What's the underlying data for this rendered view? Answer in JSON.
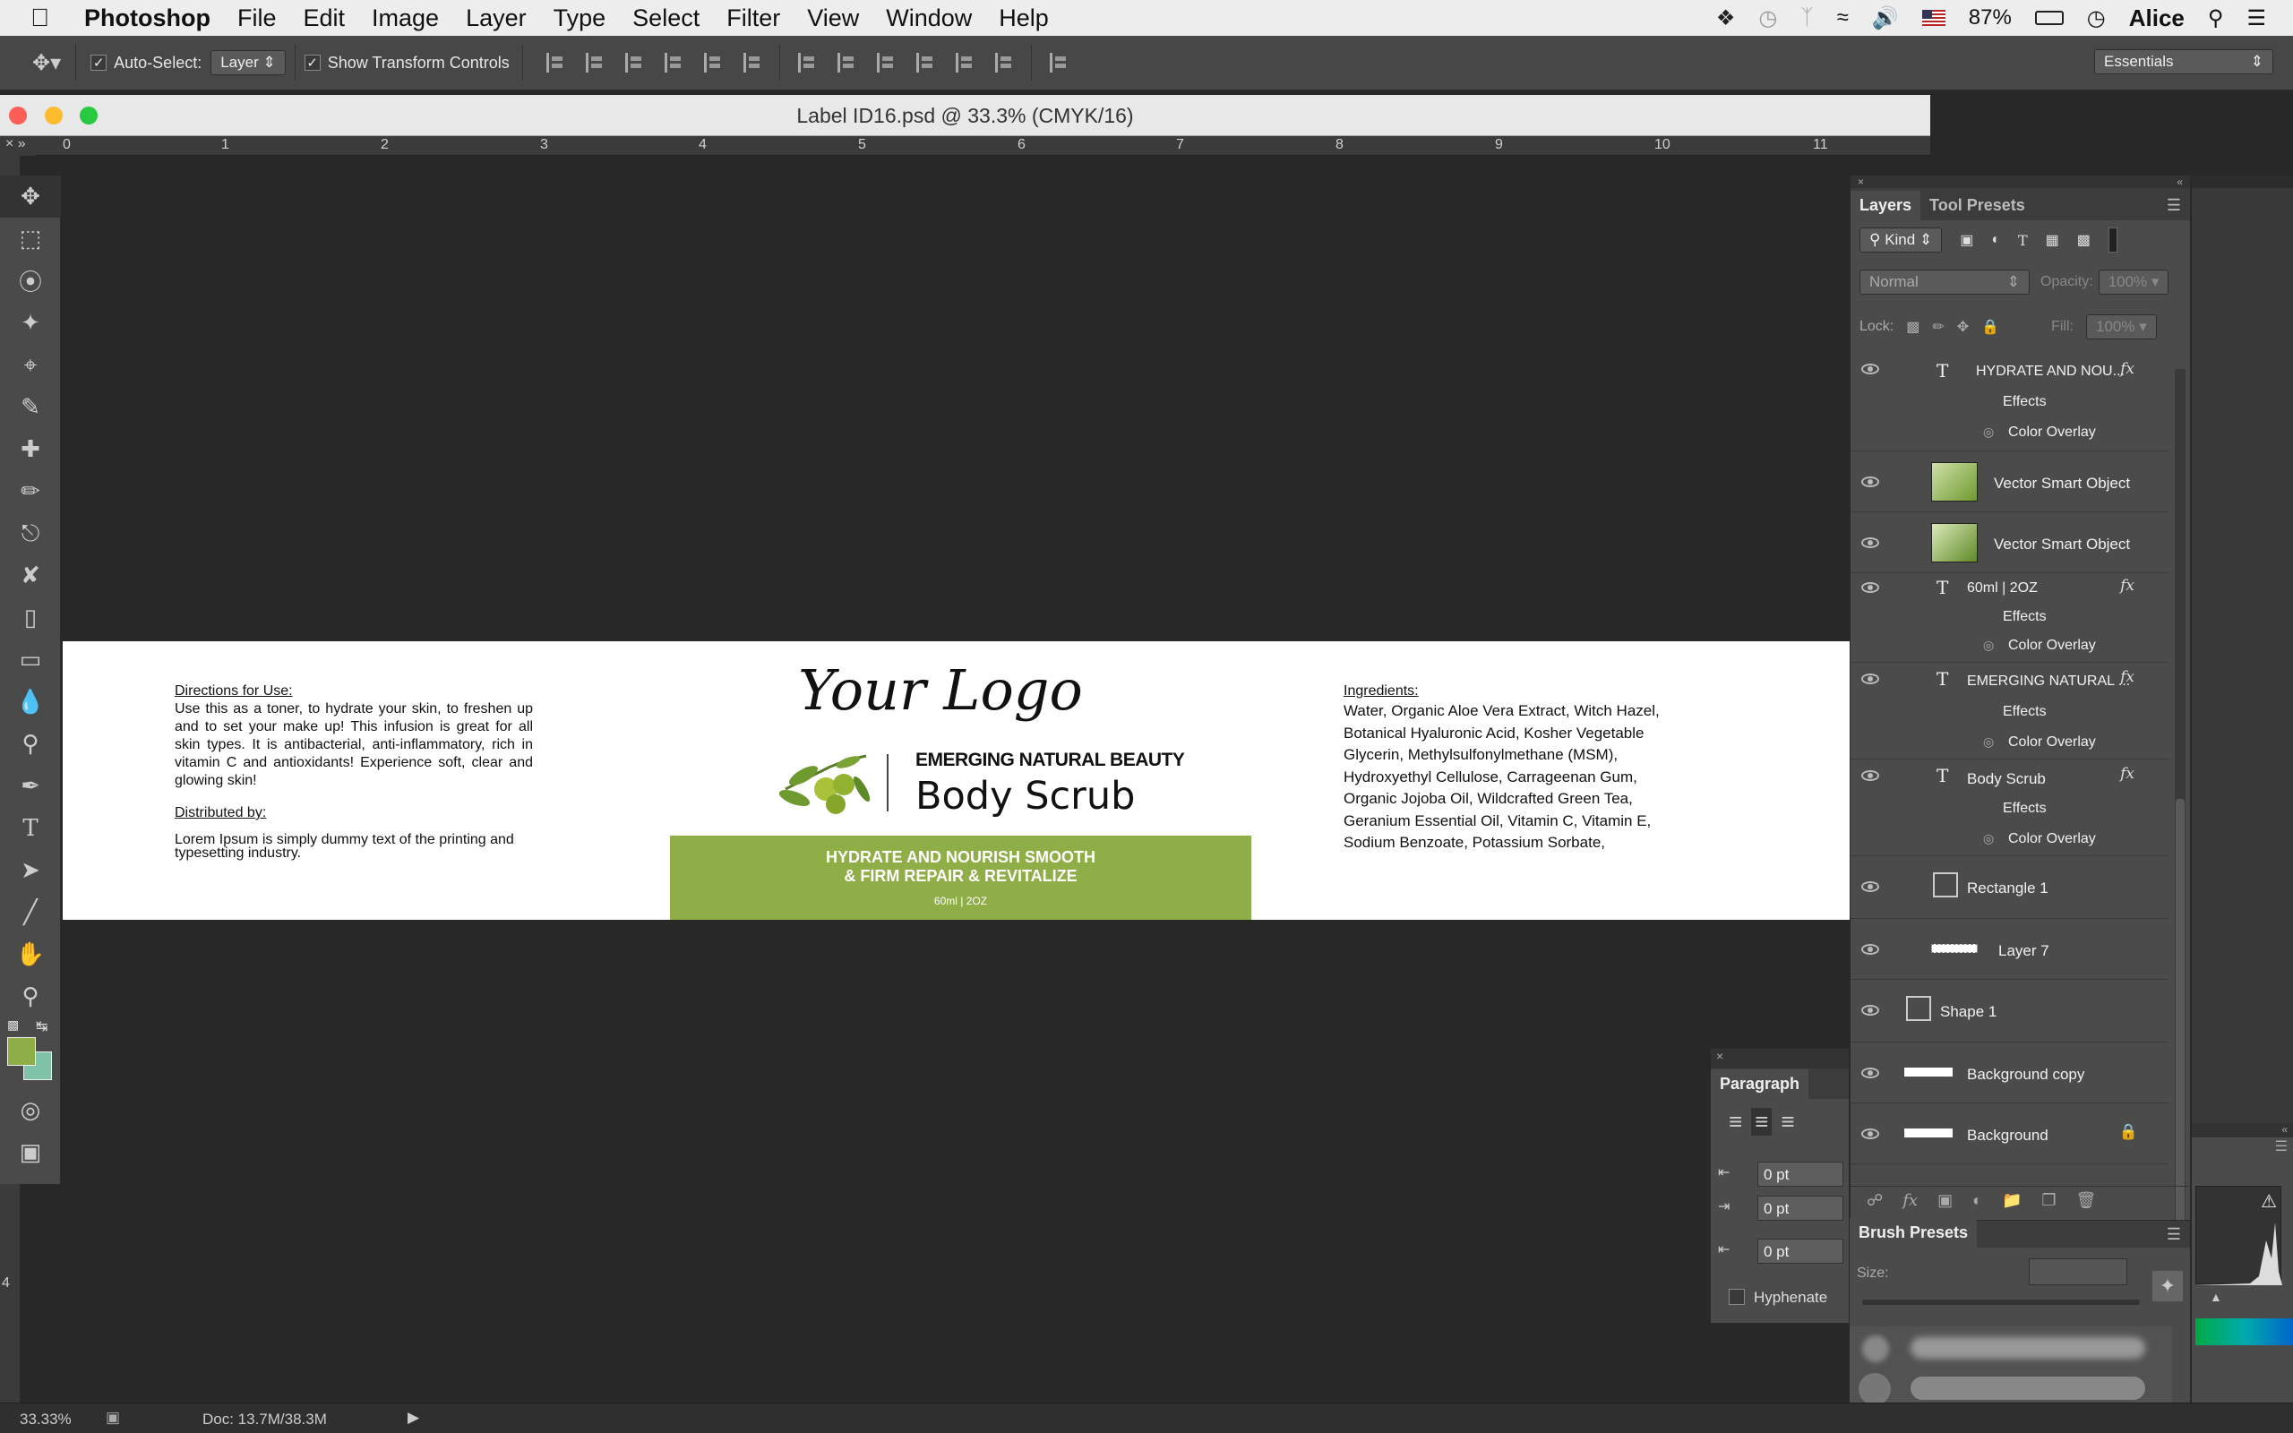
{
  "menubar": {
    "apple": "",
    "app": "Photoshop",
    "items": [
      "File",
      "Edit",
      "Image",
      "Layer",
      "Type",
      "Select",
      "Filter",
      "View",
      "Window",
      "Help"
    ],
    "battery": "87%",
    "user": "Alice"
  },
  "options": {
    "auto_select_label": "Auto-Select:",
    "auto_select_value": "Layer",
    "transform_label": "Show Transform Controls",
    "workspace": "Essentials"
  },
  "document": {
    "title": "Label ID16.psd @ 33.3% (CMYK/16)",
    "ruler_numbers": [
      "0",
      "1",
      "2",
      "3",
      "4",
      "5",
      "6",
      "7",
      "8",
      "9",
      "10",
      "11"
    ],
    "vruler_number": "4"
  },
  "label": {
    "directions_title": "Directions for Use:",
    "directions_text": "Use this as a toner, to hydrate your skin, to freshen up and to set your make up! This infusion is great for all skin types. It is antibacterial, anti-inflammatory, rich in vitamin C and antioxidants! Experience soft, clear and glowing skin!",
    "distributed_title": "Distributed by:",
    "distributed_text": "Lorem Ipsum is simply dummy text of the printing and typesetting industry.",
    "logo": "Your Logo",
    "brand": "EMERGING NATURAL BEAUTY",
    "product": "Body Scrub",
    "banner_line1": "HYDRATE AND NOURISH SMOOTH",
    "banner_line2": "& FIRM REPAIR & REVITALIZE",
    "banner_size": "60ml  |  2OZ",
    "ingredients_title": "Ingredients:",
    "ingredients_text": "Water, Organic Aloe Vera Extract, Witch Hazel, Botanical Hyaluronic Acid, Kosher Vegetable Glycerin, Methylsulfonylmethane (MSM), Hydroxyethyl Cellulose, Carrageenan Gum, Organic Jojoba Oil, Wildcrafted Green Tea, Geranium Essential Oil, Vitamin C, Vitamin E, Sodium Benzoate, Potassium Sorbate,"
  },
  "layers_panel": {
    "tab_layers": "Layers",
    "tab_presets": "Tool Presets",
    "kind": "Kind",
    "blend": "Normal",
    "opacity_label": "Opacity:",
    "opacity_value": "100%",
    "lock_label": "Lock:",
    "fill_label": "Fill:",
    "fill_value": "100%",
    "effects": "Effects",
    "color_overlay": "Color Overlay",
    "layers": [
      {
        "name": "HYDRATE AND NOU..."
      },
      {
        "name": "Vector Smart Object"
      },
      {
        "name": "Vector Smart Object"
      },
      {
        "name": "60ml | 2OZ"
      },
      {
        "name": "EMERGING NATURAL ..."
      },
      {
        "name": "Body Scrub"
      },
      {
        "name": "Rectangle 1"
      },
      {
        "name": "Layer 7"
      },
      {
        "name": "Shape 1"
      },
      {
        "name": "Background copy"
      },
      {
        "name": "Background"
      }
    ]
  },
  "brush_panel": {
    "title": "Brush Presets",
    "size_label": "Size:"
  },
  "paragraph_panel": {
    "title": "Paragraph",
    "indent1": "0 pt",
    "indent2": "0 pt",
    "indent3": "0 pt",
    "hyphenate": "Hyphenate"
  },
  "status": {
    "zoom": "33.33%",
    "doc": "Doc: 13.7M/38.3M"
  },
  "colors": {
    "foreground": "#8fae47",
    "background": "#7fc2a8",
    "label_green": "#8fae47"
  }
}
